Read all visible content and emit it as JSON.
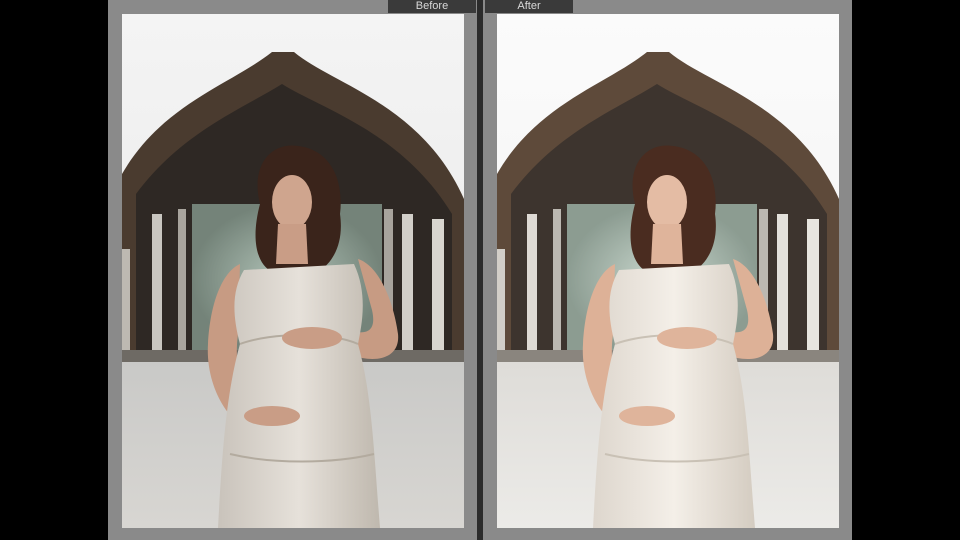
{
  "labels": {
    "before": "Before",
    "after": "After"
  },
  "colors": {
    "background": "#000000",
    "compare_frame": "#8a8a8a",
    "label_bg": "#3a3a3a",
    "label_text": "#d9d9d9"
  }
}
